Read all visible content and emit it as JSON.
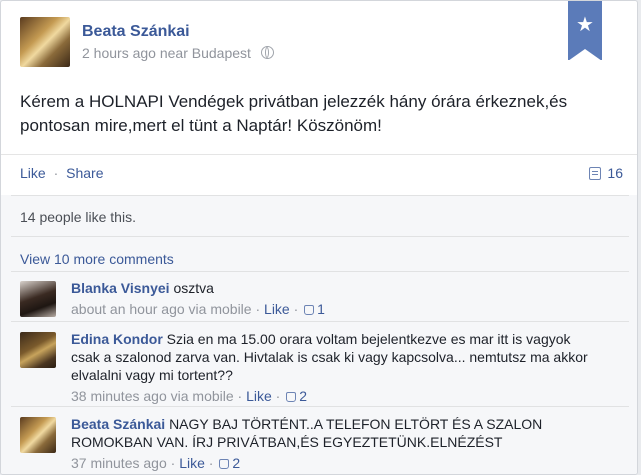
{
  "post": {
    "author": "Beata Szánkai",
    "time": "2 hours ago",
    "near": "near",
    "location": "Budapest",
    "text": "Kérem a HOLNAPI Vendégek privátban jelezzék hány órára érkeznek,és pontosan mire,mert el tünt a Naptár! Köszönöm!",
    "actions": {
      "like": "Like",
      "separator": "·",
      "share": "Share"
    },
    "comment_count": "16"
  },
  "feedback": {
    "likes_text": "14 people like this.",
    "view_more": "View 10 more comments"
  },
  "comments": [
    {
      "name": "Blanka Visnyei",
      "text": "osztva",
      "time": "about an hour ago via mobile",
      "like": "Like",
      "likes": "1"
    },
    {
      "name": "Edina Kondor",
      "text": "Szia en ma 15.00 orara voltam bejelentkezve es mar itt is vagyok csak a szalonod zarva van. Hivtalak is csak ki vagy kapcsolva... nemtutsz ma akkor elvalalni vagy mi tortent??",
      "time": "38 minutes ago via mobile",
      "like": "Like",
      "likes": "2"
    },
    {
      "name": "Beata Szánkai",
      "text": "NAGY BAJ TÖRTÉNT..A TELEFON ELTÖRT ÉS A SZALON ROMOKBAN VAN. ÍRJ PRIVÁTBAN,ÉS EGYEZTETÜNK.ELNÉZÉST",
      "time": "37 minutes ago",
      "like": "Like",
      "likes": "2"
    }
  ]
}
